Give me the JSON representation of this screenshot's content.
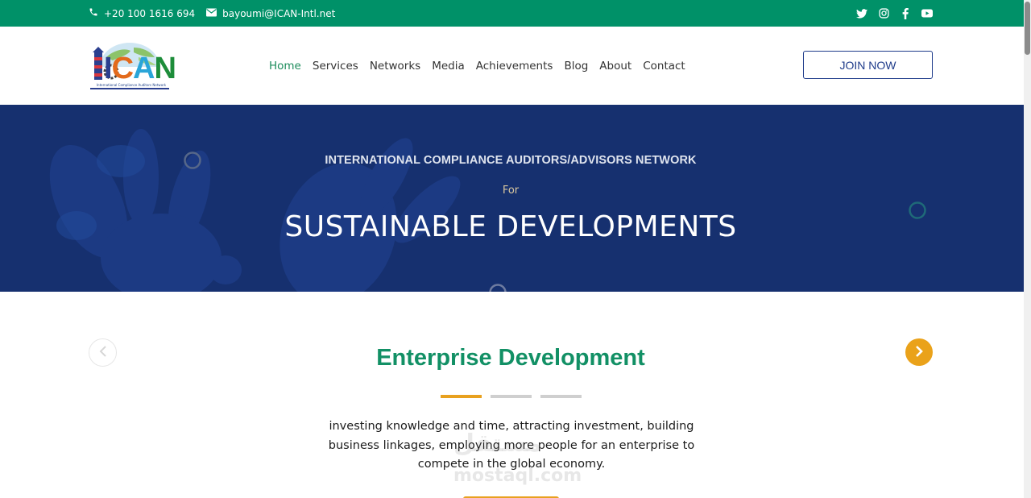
{
  "topbar": {
    "phone": "+20 100 1616 694",
    "email": "bayoumi@ICAN-Intl.net",
    "social_icons": [
      "twitter-icon",
      "instagram-icon",
      "facebook-icon",
      "youtube-icon"
    ],
    "bg_color": "#009168"
  },
  "logo": {
    "letters": [
      "I",
      "C",
      "A",
      "N"
    ],
    "subtitle": "International Compliance Auditors Network"
  },
  "nav": {
    "items": [
      {
        "label": "Home",
        "active": true
      },
      {
        "label": "Services",
        "active": false
      },
      {
        "label": "Networks",
        "active": false
      },
      {
        "label": "Media",
        "active": false
      },
      {
        "label": "Achievements",
        "active": false
      },
      {
        "label": "Blog",
        "active": false
      },
      {
        "label": "About",
        "active": false
      },
      {
        "label": "Contact",
        "active": false
      }
    ],
    "active_color": "#1c8c5b"
  },
  "join": {
    "label": "JOIN NOW"
  },
  "hero": {
    "kicker": "INTERNATIONAL COMPLIANCE AUDITORS/ADVISORS NETWORK",
    "for": "For",
    "title": "SUSTAINABLE DEVELOPMENTS",
    "bg_color": "#16306f"
  },
  "slider": {
    "title": "Enterprise Development",
    "description": "investing knowledge and time, attracting investment, building business linkages, employing more people for an enterprise to compete in the global economy.",
    "active_dot": 1,
    "dot_count": 3,
    "accent_color": "#e8a11f",
    "title_color": "#129065"
  },
  "watermark": {
    "arabic": "مستقل",
    "latin": "mostaql.com"
  }
}
